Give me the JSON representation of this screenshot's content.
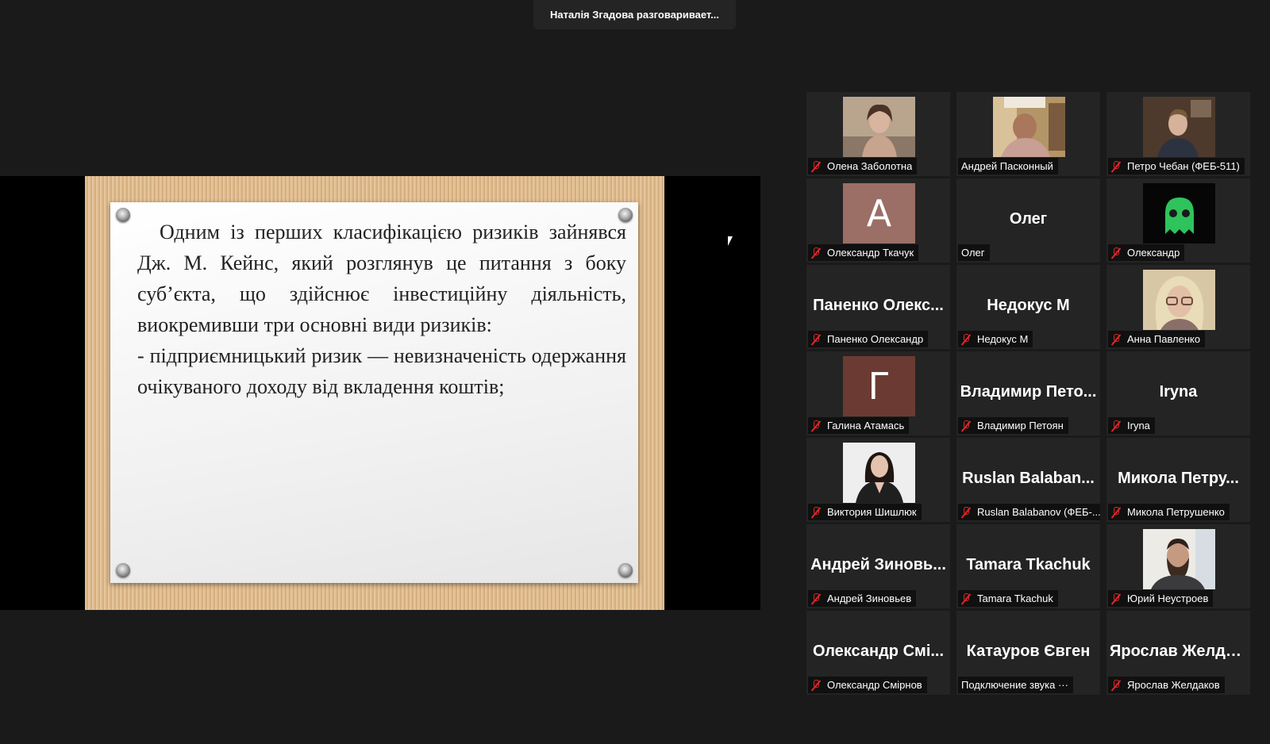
{
  "banner": {
    "text": "Наталія Згадова разговаривает..."
  },
  "slide": {
    "paragraph1": "Одним із перших класифікацією ризиків зайнявся Дж. М. Кейнс, який розглянув це питання з боку суб’єкта, що здійснює інвестиційну діяльність, виокремивши три основні види ризиків:",
    "paragraph2": "-  підприємницький ризик — невизначеність одержання очікуваного доходу від вкладення коштів;"
  },
  "tiles": [
    {
      "label": "Олена Заболотна",
      "muted": true,
      "kind": "photo",
      "photo": "woman-photo"
    },
    {
      "label": "Андрей Пасконный",
      "muted": false,
      "kind": "photo",
      "photo": "man-room-photo"
    },
    {
      "label": "Петро Чебан (ФЕБ-511)",
      "muted": true,
      "kind": "photo",
      "photo": "man-dark-photo"
    },
    {
      "label": "Олександр Ткачук",
      "muted": true,
      "kind": "avatar",
      "letter": "A",
      "color": "#9b6e66"
    },
    {
      "label": "Олег",
      "muted": false,
      "kind": "name",
      "center": "Олег"
    },
    {
      "label": "Олександр",
      "muted": true,
      "kind": "photo",
      "photo": "ghost-avatar"
    },
    {
      "label": "Паненко Олександр",
      "muted": true,
      "kind": "name",
      "center": "Паненко Олекс..."
    },
    {
      "label": "Недокус М",
      "muted": true,
      "kind": "name",
      "center": "Недокус М"
    },
    {
      "label": "Анна Павленко",
      "muted": true,
      "kind": "photo",
      "photo": "woman-glasses-photo"
    },
    {
      "label": "Галина Атамась",
      "muted": true,
      "kind": "avatar",
      "letter": "Г",
      "color": "#6b3b33"
    },
    {
      "label": "Владимир Петоян",
      "muted": true,
      "kind": "name",
      "center": "Владимир Пето..."
    },
    {
      "label": "Iryna",
      "muted": true,
      "kind": "name",
      "center": "Iryna"
    },
    {
      "label": "Виктория Шишлюк",
      "muted": true,
      "kind": "photo",
      "photo": "woman-portrait-photo"
    },
    {
      "label": "Ruslan Balabanov (ФЕБ-...",
      "muted": true,
      "kind": "name",
      "center": "Ruslan Balaban..."
    },
    {
      "label": "Микола Петрушенко",
      "muted": true,
      "kind": "name",
      "center": "Микола Петру..."
    },
    {
      "label": "Андрей Зиновьев",
      "muted": true,
      "kind": "name",
      "center": "Андрей Зиновь..."
    },
    {
      "label": "Tamara Tkachuk",
      "muted": true,
      "kind": "name",
      "center": "Tamara Tkachuk"
    },
    {
      "label": "Юрий Неустроев",
      "muted": true,
      "kind": "photo",
      "photo": "bearded-man-photo"
    },
    {
      "label": "Олександр Смірнов",
      "muted": true,
      "kind": "name",
      "center": "Олександр Смі..."
    },
    {
      "label": "Подключение звука ···",
      "muted": false,
      "kind": "name",
      "center": "Катауров Євген"
    },
    {
      "label": "Ярослав Желдаков",
      "muted": true,
      "kind": "name",
      "center": "Ярослав Желда..."
    }
  ]
}
